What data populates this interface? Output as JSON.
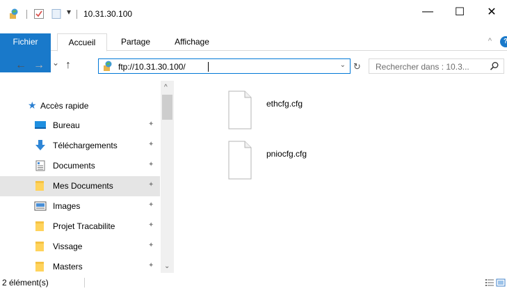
{
  "window": {
    "title": "10.31.30.100",
    "minimize_glyph": "—",
    "maximize_glyph": "☐",
    "close_glyph": "✕",
    "qat_dropdown_glyph": "▾"
  },
  "ribbon": {
    "tabs": [
      "Fichier",
      "Accueil",
      "Partage",
      "Affichage"
    ],
    "collapse_glyph": "^",
    "help_glyph": "?"
  },
  "address": {
    "back_glyph": "←",
    "forward_glyph": "→",
    "recent_glyph": "⌄",
    "up_glyph": "↑",
    "path": "ftp://10.31.30.100/",
    "dropdown_glyph": "⌄",
    "refresh_glyph": "↻",
    "search_placeholder": "Rechercher dans : 10.3..."
  },
  "nav_pane": {
    "quick_access": "Accès rapide",
    "pin_glyph": "✦",
    "items": [
      {
        "label": "Bureau",
        "icon": "desktop-icon"
      },
      {
        "label": "Téléchargements",
        "icon": "downloads-icon"
      },
      {
        "label": "Documents",
        "icon": "documents-icon"
      },
      {
        "label": "Mes Documents",
        "icon": "folder-icon",
        "selected": true
      },
      {
        "label": "Images",
        "icon": "images-icon"
      },
      {
        "label": "Projet Tracabilite",
        "icon": "folder-icon"
      },
      {
        "label": "Vissage",
        "icon": "folder-icon"
      },
      {
        "label": "Masters",
        "icon": "folder-icon"
      }
    ],
    "scroll_up_glyph": "^",
    "scroll_down_glyph": "⌄"
  },
  "files": [
    {
      "name": "ethcfg.cfg",
      "icon": "file-icon"
    },
    {
      "name": "pniocfg.cfg",
      "icon": "file-icon"
    }
  ],
  "status": {
    "count": "2 élément(s)"
  },
  "colors": {
    "accent": "#1979ca",
    "selected": "#e5e5e5",
    "folder": "#ffd35c"
  }
}
